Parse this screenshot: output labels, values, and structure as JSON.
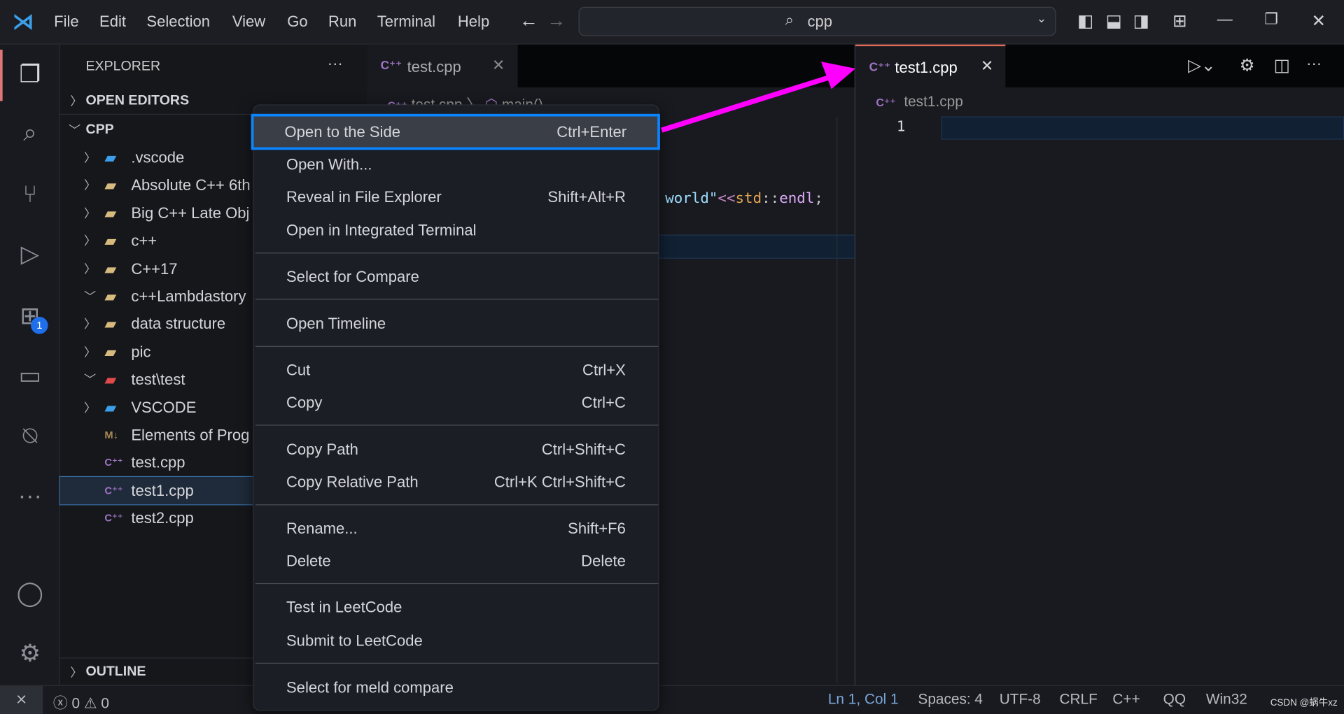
{
  "menu": [
    "File",
    "Edit",
    "Selection",
    "View",
    "Go",
    "Run",
    "Terminal",
    "Help"
  ],
  "search": {
    "value": "cpp"
  },
  "activity": {
    "extensions_badge": "1"
  },
  "sidebar": {
    "title": "EXPLORER",
    "more": "···",
    "open_editors": "OPEN EDITORS",
    "root": "CPP",
    "outline": "OUTLINE",
    "items": [
      {
        "label": ".vscode",
        "type": "vscode-folder",
        "expanded": false
      },
      {
        "label": "Absolute C++ 6th",
        "type": "folder",
        "expanded": false
      },
      {
        "label": "Big C++ Late Obj",
        "type": "folder",
        "expanded": false
      },
      {
        "label": "c++",
        "type": "folder",
        "expanded": false
      },
      {
        "label": "C++17",
        "type": "folder",
        "expanded": false
      },
      {
        "label": "c++Lambdastory",
        "type": "folder",
        "expanded": true
      },
      {
        "label": "data structure",
        "type": "folder",
        "expanded": false
      },
      {
        "label": "pic",
        "type": "folder",
        "expanded": false
      },
      {
        "label": "test\\test",
        "type": "test-folder",
        "expanded": true
      },
      {
        "label": "VSCODE",
        "type": "vscode-folder",
        "expanded": false
      },
      {
        "label": "Elements of Prog",
        "type": "markdown"
      },
      {
        "label": "test.cpp",
        "type": "cpp"
      },
      {
        "label": "test1.cpp",
        "type": "cpp",
        "selected": true
      },
      {
        "label": "test2.cpp",
        "type": "cpp"
      }
    ]
  },
  "editor1": {
    "tab": "test.cpp",
    "close": "✕",
    "breadcrumb": [
      "test.cpp",
      "main()"
    ],
    "code": {
      "a": "world\"",
      "b": "<<",
      "c": "std",
      "d": "::",
      "e": "endl",
      ";": ";"
    }
  },
  "editor2": {
    "tab": "test1.cpp",
    "close": "✕",
    "breadcrumb": "test1.cpp",
    "line": "1"
  },
  "context_menu": [
    {
      "label": "Open to the Side",
      "key": "Ctrl+Enter",
      "highlighted": true
    },
    {
      "label": "Open With...",
      "key": ""
    },
    {
      "label": "Reveal in File Explorer",
      "key": "Shift+Alt+R"
    },
    {
      "label": "Open in Integrated Terminal",
      "key": ""
    },
    {
      "label": "Select for Compare",
      "key": ""
    },
    {
      "label": "Open Timeline",
      "key": ""
    },
    {
      "label": "Cut",
      "key": "Ctrl+X"
    },
    {
      "label": "Copy",
      "key": "Ctrl+C"
    },
    {
      "label": "Copy Path",
      "key": "Ctrl+Shift+C"
    },
    {
      "label": "Copy Relative Path",
      "key": "Ctrl+K Ctrl+Shift+C"
    },
    {
      "label": "Rename...",
      "key": "Shift+F6"
    },
    {
      "label": "Delete",
      "key": "Delete"
    },
    {
      "label": "Test in LeetCode",
      "key": ""
    },
    {
      "label": "Submit to LeetCode",
      "key": ""
    },
    {
      "label": "Select for meld compare",
      "key": ""
    }
  ],
  "status": {
    "errors": "0",
    "warnings": "0",
    "position": "Ln 1, Col 1",
    "spaces": "Spaces: 4",
    "encoding": "UTF-8",
    "eol": "CRLF",
    "language": "C++",
    "qq": "QQ",
    "platform": "Win32",
    "watermark": "CSDN @蜗牛xz"
  },
  "colors": {
    "annotation_arrow": "#ff00ff",
    "highlight_border": "#0a84ff",
    "accent": "#007acc"
  }
}
